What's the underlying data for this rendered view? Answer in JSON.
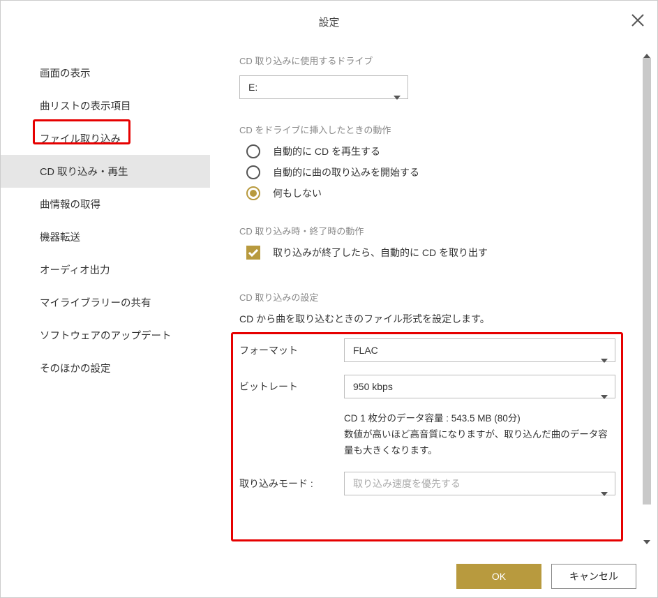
{
  "title": "設定",
  "sidebar": {
    "items": [
      {
        "label": "画面の表示"
      },
      {
        "label": "曲リストの表示項目"
      },
      {
        "label": "ファイル取り込み"
      },
      {
        "label": "CD 取り込み・再生",
        "selected": true
      },
      {
        "label": "曲情報の取得"
      },
      {
        "label": "機器転送"
      },
      {
        "label": "オーディオ出力"
      },
      {
        "label": "マイライブラリーの共有"
      },
      {
        "label": "ソフトウェアのアップデート"
      },
      {
        "label": "そのほかの設定"
      }
    ]
  },
  "sections": {
    "drive": {
      "heading": "CD 取り込みに使用するドライブ",
      "value": "E:"
    },
    "insert": {
      "heading": "CD をドライブに挿入したときの動作",
      "options": [
        {
          "label": "自動的に CD を再生する",
          "checked": false
        },
        {
          "label": "自動的に曲の取り込みを開始する",
          "checked": false
        },
        {
          "label": "何もしない",
          "checked": true
        }
      ]
    },
    "finish": {
      "heading": "CD 取り込み時・終了時の動作",
      "check": {
        "label": "取り込みが終了したら、自動的に CD を取り出す",
        "checked": true
      }
    },
    "rip": {
      "heading": "CD 取り込みの設定",
      "desc": "CD から曲を取り込むときのファイル形式を設定します。",
      "format_label": "フォーマット",
      "format_value": "FLAC",
      "bitrate_label": "ビットレート",
      "bitrate_value": "950 kbps",
      "size_note": "CD 1 枚分のデータ容量 : 543.5 MB (80分)",
      "quality_note": "数値が高いほど高音質になりますが、取り込んだ曲のデータ容量も大きくなります。",
      "mode_label": "取り込みモード :",
      "mode_value": "取り込み速度を優先する"
    }
  },
  "footer": {
    "ok": "OK",
    "cancel": "キャンセル"
  }
}
